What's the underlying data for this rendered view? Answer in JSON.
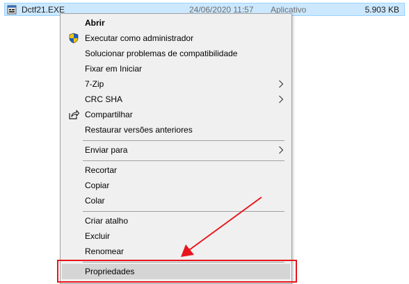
{
  "file": {
    "name": "Dctf21.EXE",
    "date": "24/06/2020 11:57",
    "type": "Aplicativo",
    "size": "5.903 KB",
    "icon": "exe-file-icon"
  },
  "menu": {
    "items": [
      {
        "label": "Abrir",
        "bold": true
      },
      {
        "label": "Executar como administrador",
        "icon": "uac-shield-icon"
      },
      {
        "label": "Solucionar problemas de compatibilidade"
      },
      {
        "label": "Fixar em Iniciar"
      },
      {
        "label": "7-Zip",
        "submenu": true
      },
      {
        "label": "CRC SHA",
        "submenu": true
      },
      {
        "label": "Compartilhar",
        "icon": "share-icon"
      },
      {
        "label": "Restaurar versões anteriores"
      },
      {
        "label": "Enviar para",
        "submenu": true
      },
      {
        "label": "Recortar"
      },
      {
        "label": "Copiar"
      },
      {
        "label": "Colar"
      },
      {
        "label": "Criar atalho"
      },
      {
        "label": "Excluir"
      },
      {
        "label": "Renomear"
      },
      {
        "label": "Propriedades",
        "highlighted": true
      }
    ]
  },
  "annotation": {
    "color": "#e8141b",
    "target": "Propriedades"
  }
}
